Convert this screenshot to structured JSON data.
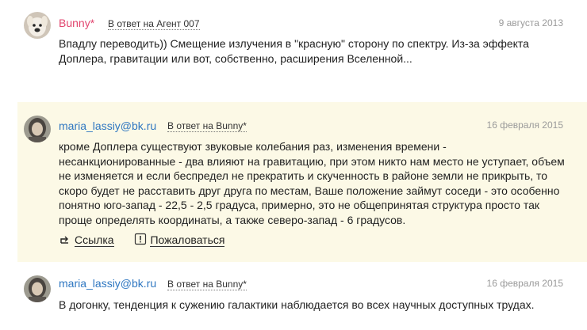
{
  "comments": [
    {
      "author": "Bunny*",
      "reply_to": "В ответ на Агент 007",
      "date": "9 августа 2013",
      "text": "Впадлу переводить)) Смещение излучения в \"красную\" сторону по спектру. Из-за эффекта Доплера, гравитации или вот, собственно, расширения Вселенной...",
      "avatar_icon": "dog-avatar-icon"
    },
    {
      "author": "maria_lassiy@bk.ru",
      "reply_to": "В ответ на Bunny*",
      "date": "16 февраля 2015",
      "text": "кроме Доплера существуют звуковые колебания раз, изменения времени - несанкционированные - два влияют на гравитацию, при этом никто нам место не уступает, объем не изменяется и если беспредел не прекратить и скученность в районе земли не прикрыть, то скоро будет не расставить друг друга по местам, Ваше положение займут соседи - это особенно понятно юго-запад - 22,5  - 2,5 градуса, примерно, это не общепринятая структура просто так проще определять координаты, а также северо-запад - 6 градусов.",
      "avatar_icon": "woman-avatar-icon",
      "actions": {
        "link": "Ссылка",
        "report": "Пожаловаться"
      }
    },
    {
      "author": "maria_lassiy@bk.ru",
      "reply_to": "В ответ на Bunny*",
      "date": "16 февраля 2015",
      "text": "В догонку, тенденция к сужению галактики наблюдается во всех научных доступных трудах.",
      "avatar_icon": "woman-avatar-icon"
    }
  ],
  "colors": {
    "author_pink": "#e2466f",
    "author_blue": "#2f77c1",
    "highlight_bg": "#fcf9e6",
    "date_gray": "#9a9a9a"
  }
}
